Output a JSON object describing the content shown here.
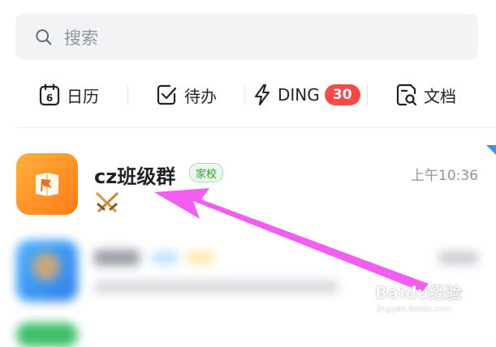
{
  "search": {
    "placeholder": "搜索",
    "icon": "search-icon"
  },
  "quickbar": {
    "calendar": {
      "label": "日历",
      "icon": "calendar-icon",
      "icon_day": "6"
    },
    "todo": {
      "label": "待办",
      "icon": "todo-check-icon"
    },
    "ding": {
      "label": "DING",
      "icon": "lightning-icon",
      "badge": "30"
    },
    "docs": {
      "label": "文档",
      "icon": "document-icon"
    }
  },
  "chats": [
    {
      "title": "cz班级群",
      "tag": "家校",
      "time": "上午10:36",
      "avatar_icon": "book-flag-icon",
      "preview_icon": "crossed-swords-icon",
      "colors": {
        "avatar_start": "#ffb03a",
        "avatar_end": "#ff7a18",
        "tag": "#2ea121"
      }
    }
  ],
  "annotation": {
    "arrow_color": "#f25ef0"
  },
  "watermark": {
    "brand": "Baidu经验",
    "url": "jingyan.baidu.com"
  },
  "colors": {
    "badge": "#f54a45",
    "search_bg": "#f2f3f5",
    "unread_corner": "#4a90e2"
  }
}
